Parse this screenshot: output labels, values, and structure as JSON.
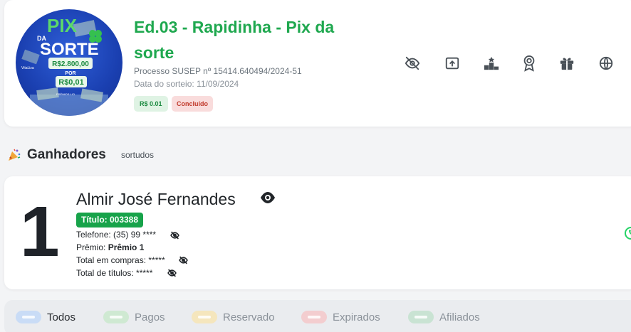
{
  "raffle": {
    "image_text": {
      "pix": "PIX",
      "da": "DA",
      "sorte": "SORTE",
      "amount": "R$2.800,00",
      "por": "POR",
      "price": "R$0,01",
      "brand_left": "VitaLiza",
      "brand_bottom": "PRÊMIOS LIO"
    },
    "title": "Ed.03 - Rapidinha - Pix da sorte",
    "susep": "Processo SUSEP nº 15414.640494/2024-51",
    "draw_date": "Data do sorteio: 11/09/2024",
    "price_badge": "R$ 0.01",
    "status_badge": "Concluído"
  },
  "top_icons": [
    "eye-slash-icon",
    "share-up-icon",
    "podium-icon",
    "award-ribbon-icon",
    "gift-icon",
    "ball-icon"
  ],
  "winners": {
    "title": "Ganhadores",
    "subtitle": "sortudos",
    "items": [
      {
        "rank": "1",
        "name": "Almir José Fernandes",
        "ticket": "Título: 003388",
        "phone_label": "Telefone: (35) 99 ****",
        "prize_label": "Prêmio:",
        "prize_value": "Prêmio 1",
        "purchases": "Total em compras: *****",
        "titles": "Total de títulos: *****"
      }
    ]
  },
  "filters": [
    {
      "label": "Todos",
      "color": "#c9dcf6",
      "active": true
    },
    {
      "label": "Pagos",
      "color": "#cfe9d2",
      "active": false
    },
    {
      "label": "Reservado",
      "color": "#f5e6bd",
      "active": false
    },
    {
      "label": "Expirados",
      "color": "#f3cdcf",
      "active": false
    },
    {
      "label": "Afiliados",
      "color": "#c9e3d3",
      "active": false
    }
  ],
  "colors": {
    "accent_green": "#1fa84f",
    "ticket_green": "#17a34a"
  }
}
